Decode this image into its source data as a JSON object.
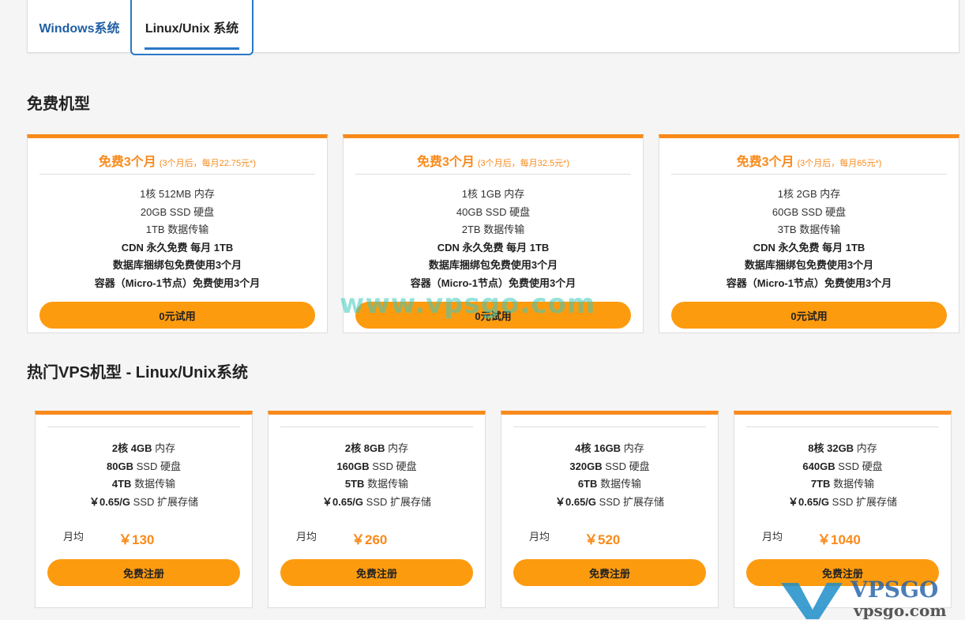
{
  "tabs": [
    {
      "label": "Windows系统",
      "active": false
    },
    {
      "label": "Linux/Unix 系统",
      "active": true
    }
  ],
  "free_section": {
    "title": "免费机型",
    "cards": [
      {
        "headline": "免费3个月",
        "note": "(3个月后，每月22.75元*)",
        "specs": [
          "1核 512MB 内存",
          "20GB SSD 硬盘",
          "1TB 数据传输"
        ],
        "perks": [
          "CDN 永久免费 每月 1TB",
          "数据库捆绑包免费使用3个月",
          "容器（Micro-1节点）免费使用3个月"
        ],
        "button": "0元试用"
      },
      {
        "headline": "免费3个月",
        "note": "(3个月后，每月32.5元*)",
        "specs": [
          "1核 1GB 内存",
          "40GB SSD 硬盘",
          "2TB 数据传输"
        ],
        "perks": [
          "CDN 永久免费 每月 1TB",
          "数据库捆绑包免费使用3个月",
          "容器（Micro-1节点）免费使用3个月"
        ],
        "button": "0元试用"
      },
      {
        "headline": "免费3个月",
        "note": "(3个月后，每月65元*)",
        "specs": [
          "1核 2GB 内存",
          "60GB SSD 硬盘",
          "3TB 数据传输"
        ],
        "perks": [
          "CDN 永久免费 每月 1TB",
          "数据库捆绑包免费使用3个月",
          "容器（Micro-1节点）免费使用3个月"
        ],
        "button": "0元试用"
      }
    ]
  },
  "hot_section": {
    "title": "热门VPS机型 - Linux/Unix系统",
    "cards": [
      {
        "cpu_mem": "2核 4GB",
        "mem_suffix": "内存",
        "disk": "80GB",
        "disk_suffix": "SSD 硬盘",
        "transfer": "4TB",
        "transfer_suffix": "数据传输",
        "storage": "￥0.65/G",
        "storage_suffix": "SSD 扩展存储",
        "price_label": "月均",
        "price": "￥130",
        "button": "免费注册"
      },
      {
        "cpu_mem": "2核 8GB",
        "mem_suffix": "内存",
        "disk": "160GB",
        "disk_suffix": "SSD 硬盘",
        "transfer": "5TB",
        "transfer_suffix": "数据传输",
        "storage": "￥0.65/G",
        "storage_suffix": "SSD 扩展存储",
        "price_label": "月均",
        "price": "￥260",
        "button": "免费注册"
      },
      {
        "cpu_mem": "4核 16GB",
        "mem_suffix": "内存",
        "disk": "320GB",
        "disk_suffix": "SSD 硬盘",
        "transfer": "6TB",
        "transfer_suffix": "数据传输",
        "storage": "￥0.65/G",
        "storage_suffix": "SSD 扩展存储",
        "price_label": "月均",
        "price": "￥520",
        "button": "免费注册"
      },
      {
        "cpu_mem": "8核 32GB",
        "mem_suffix": "内存",
        "disk": "640GB",
        "disk_suffix": "SSD 硬盘",
        "transfer": "7TB",
        "transfer_suffix": "数据传输",
        "storage": "￥0.65/G",
        "storage_suffix": "SSD 扩展存储",
        "price_label": "月均",
        "price": "￥1040",
        "button": "免费注册"
      }
    ]
  },
  "watermark": "www.vpsgo.com",
  "logo": {
    "brand": "VPSGO",
    "url_text": "vpsgo.com"
  },
  "colors": {
    "accent": "#f98a1b",
    "button": "#fd9b0f",
    "tab_blue": "#2b78c5"
  }
}
